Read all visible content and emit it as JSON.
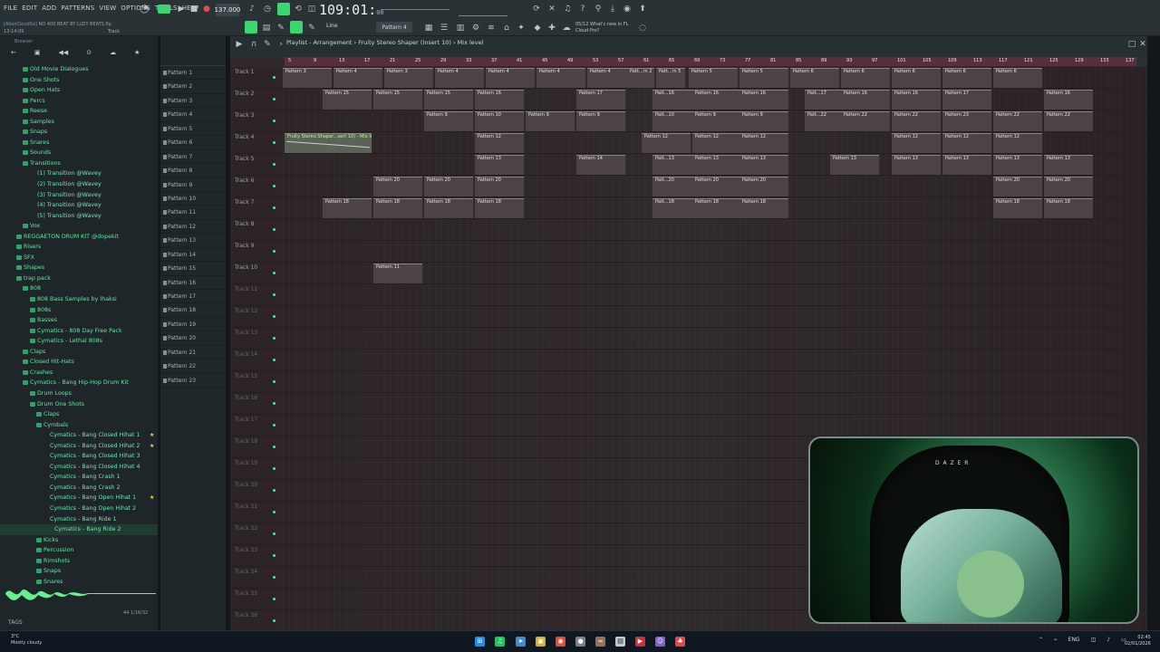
{
  "menu": [
    "FILE",
    "EDIT",
    "ADD",
    "PATTERNS",
    "VIEW",
    "OPTIONS",
    "TOOLS",
    "HELP"
  ],
  "project": {
    "hint": "[AlienCloudSo]",
    "title": "NO 400 BEAT BY LUZY BEATS.flp",
    "time": "13:14:09",
    "track": "Track 3"
  },
  "tempo": "137.000",
  "clock_main": "109:01",
  "clock_small": "00",
  "pattern_select": "Pattern 4",
  "news": [
    "05/12",
    "What's new in FL",
    "Cloud Pro?"
  ],
  "playlist_title": "Playlist - Arrangement › Fruity Stereo Shaper (Insert 10) › Mix level",
  "browser_label": "Browser",
  "browser_items": [
    {
      "label": "Old Movie Dialogues",
      "indent": 1,
      "type": "folder"
    },
    {
      "label": "One Shots",
      "indent": 1,
      "type": "folder"
    },
    {
      "label": "Open Hats",
      "indent": 1,
      "type": "folder"
    },
    {
      "label": "Percs",
      "indent": 1,
      "type": "folder"
    },
    {
      "label": "Reese",
      "indent": 1,
      "type": "folder"
    },
    {
      "label": "Samples",
      "indent": 1,
      "type": "folder"
    },
    {
      "label": "Snaps",
      "indent": 1,
      "type": "folder"
    },
    {
      "label": "Snares",
      "indent": 1,
      "type": "folder"
    },
    {
      "label": "Sounds",
      "indent": 1,
      "type": "folder"
    },
    {
      "label": "Transitions",
      "indent": 1,
      "type": "folder"
    },
    {
      "label": "(1) Transition @Wavey",
      "indent": 2,
      "type": "file"
    },
    {
      "label": "(2) Transition @Wavey",
      "indent": 2,
      "type": "file"
    },
    {
      "label": "(3) Transition @Wavey",
      "indent": 2,
      "type": "file"
    },
    {
      "label": "(4) Transition @Wavey",
      "indent": 2,
      "type": "file"
    },
    {
      "label": "(5) Transition @Wavey",
      "indent": 2,
      "type": "file"
    },
    {
      "label": "Vox",
      "indent": 1,
      "type": "folder"
    },
    {
      "label": "REGGAETON DRUM KIT @dopekit",
      "indent": 0,
      "type": "folder"
    },
    {
      "label": "Risers",
      "indent": 0,
      "type": "folder"
    },
    {
      "label": "SFX",
      "indent": 0,
      "type": "folder"
    },
    {
      "label": "Shapes",
      "indent": 0,
      "type": "folder"
    },
    {
      "label": "trap pack",
      "indent": 0,
      "type": "folder"
    },
    {
      "label": "808",
      "indent": 1,
      "type": "folder"
    },
    {
      "label": "808 Bass Samples by Ihaksi",
      "indent": 2,
      "type": "folder"
    },
    {
      "label": "808s",
      "indent": 2,
      "type": "folder"
    },
    {
      "label": "Basses",
      "indent": 2,
      "type": "folder"
    },
    {
      "label": "Cymatics - 808 Day Free Pack",
      "indent": 2,
      "type": "folder"
    },
    {
      "label": "Cymatics - Lethal 808s",
      "indent": 2,
      "type": "folder"
    },
    {
      "label": "Claps",
      "indent": 1,
      "type": "folder"
    },
    {
      "label": "Closed Hit-Hats",
      "indent": 1,
      "type": "folder"
    },
    {
      "label": "Crashes",
      "indent": 1,
      "type": "folder"
    },
    {
      "label": "Cymatics - Bang Hip-Hop Drum Kit",
      "indent": 1,
      "type": "folder"
    },
    {
      "label": "Drum Loops",
      "indent": 2,
      "type": "folder"
    },
    {
      "label": "Drum One Shots",
      "indent": 2,
      "type": "folder"
    },
    {
      "label": "Claps",
      "indent": 3,
      "type": "folder"
    },
    {
      "label": "Cymbals",
      "indent": 3,
      "type": "folder"
    },
    {
      "label": "Cymatics - Bang Closed Hihat 1",
      "indent": 4,
      "type": "file",
      "star": true
    },
    {
      "label": "Cymatics - Bang Closed Hihat 2",
      "indent": 4,
      "type": "file",
      "star": true
    },
    {
      "label": "Cymatics - Bang Closed Hihat 3",
      "indent": 4,
      "type": "file"
    },
    {
      "label": "Cymatics - Bang Closed Hihat 4",
      "indent": 4,
      "type": "file"
    },
    {
      "label": "Cymatics - Bang Crash 1",
      "indent": 4,
      "type": "file"
    },
    {
      "label": "Cymatics - Bang Crash 2",
      "indent": 4,
      "type": "file"
    },
    {
      "label": "Cymatics - Bang Open Hihat 1",
      "indent": 4,
      "type": "file",
      "star": true
    },
    {
      "label": "Cymatics - Bang Open Hihat 2",
      "indent": 4,
      "type": "file"
    },
    {
      "label": "Cymatics - Bang Ride 1",
      "indent": 4,
      "type": "file"
    },
    {
      "label": "Cymatics - Bang Ride 2",
      "indent": 5,
      "type": "file",
      "selected": true
    },
    {
      "label": "Kicks",
      "indent": 3,
      "type": "folder"
    },
    {
      "label": "Percussion",
      "indent": 3,
      "type": "folder"
    },
    {
      "label": "Rimshots",
      "indent": 3,
      "type": "folder"
    },
    {
      "label": "Snaps",
      "indent": 3,
      "type": "folder"
    },
    {
      "label": "Snares",
      "indent": 3,
      "type": "folder"
    }
  ],
  "sample_rate": "44.1/16/32",
  "tags_label": "TAGS",
  "patterns": [
    "Pattern 1",
    "Pattern 2",
    "Pattern 3",
    "Pattern 4",
    "Pattern 5",
    "Pattern 6",
    "Pattern 7",
    "Pattern 8",
    "Pattern 9",
    "Pattern 10",
    "Pattern 11",
    "Pattern 12",
    "Pattern 13",
    "Pattern 14",
    "Pattern 15",
    "Pattern 16",
    "Pattern 17",
    "Pattern 18",
    "Pattern 19",
    "Pattern 20",
    "Pattern 21",
    "Pattern 22",
    "Pattern 23"
  ],
  "ruler": [
    "5",
    "9",
    "13",
    "17",
    "21",
    "25",
    "29",
    "33",
    "37",
    "41",
    "45",
    "49",
    "53",
    "57",
    "61",
    "65",
    "69",
    "73",
    "77",
    "81",
    "85",
    "89",
    "93",
    "97",
    "101",
    "105",
    "109",
    "113",
    "117",
    "121",
    "125",
    "129",
    "133",
    "137"
  ],
  "tracks": [
    "Track 1",
    "Track 2",
    "Track 3",
    "Track 4",
    "Track 5",
    "Track 6",
    "Track 7",
    "Track 8",
    "Track 9",
    "Track 10",
    "Track 11",
    "Track 12",
    "Track 13",
    "Track 14",
    "Track 15",
    "Track 16",
    "Track 17",
    "Track 18",
    "Track 19",
    "Track 20",
    "Track 21",
    "Track 22",
    "Track 23",
    "Track 24",
    "Track 25",
    "Track 26"
  ],
  "clips": [
    {
      "row": 0,
      "label": "Pattern 3"
    },
    {
      "row": 0,
      "label": "Pattern 4"
    },
    {
      "row": 0,
      "label": "Pattern 3"
    },
    {
      "row": 0,
      "label": "Pattern 4"
    },
    {
      "row": 0,
      "label": "Pattern 4"
    },
    {
      "row": 0,
      "label": "Pattern 4"
    },
    {
      "row": 0,
      "label": "Pattern 4"
    },
    {
      "row": 0,
      "label": "Patt...rn 2"
    },
    {
      "row": 0,
      "label": "Patt...rn 5"
    },
    {
      "row": 0,
      "label": "Pattern 5"
    },
    {
      "row": 0,
      "label": "Pattern 5"
    },
    {
      "row": 0,
      "label": "Pattern 6"
    },
    {
      "row": 0,
      "label": "Pattern 6"
    },
    {
      "row": 0,
      "label": "Pattern 6"
    },
    {
      "row": 0,
      "label": "Pattern 6"
    },
    {
      "row": 0,
      "label": "Pattern 6"
    },
    {
      "row": 1,
      "label": "Pattern 15"
    },
    {
      "row": 1,
      "label": "Pattern 15"
    },
    {
      "row": 1,
      "label": "Pattern 15"
    },
    {
      "row": 1,
      "label": "Pattern 16"
    },
    {
      "row": 1,
      "label": "Pattern 17"
    },
    {
      "row": 1,
      "label": "Patt...16"
    },
    {
      "row": 1,
      "label": "Pattern 16"
    },
    {
      "row": 1,
      "label": "Pattern 16"
    },
    {
      "row": 1,
      "label": "Patt...17"
    },
    {
      "row": 1,
      "label": "Pattern 16"
    },
    {
      "row": 1,
      "label": "Pattern 16"
    },
    {
      "row": 1,
      "label": "Pattern 17"
    },
    {
      "row": 1,
      "label": "Pattern 16"
    },
    {
      "row": 2,
      "label": "Pattern 9"
    },
    {
      "row": 2,
      "label": "Pattern 10"
    },
    {
      "row": 2,
      "label": "Pattern 9"
    },
    {
      "row": 2,
      "label": "Pattern 9"
    },
    {
      "row": 2,
      "label": "Patt...10"
    },
    {
      "row": 2,
      "label": "Pattern 9"
    },
    {
      "row": 2,
      "label": "Pattern 9"
    },
    {
      "row": 2,
      "label": "Patt...22"
    },
    {
      "row": 2,
      "label": "Pattern 22"
    },
    {
      "row": 2,
      "label": "Pattern 22"
    },
    {
      "row": 2,
      "label": "Pattern 23"
    },
    {
      "row": 2,
      "label": "Pattern 22"
    },
    {
      "row": 2,
      "label": "Pattern 22"
    },
    {
      "row": 3,
      "label": "Fruity Stereo Shaper...sert 10) - Mix level",
      "fx": true
    },
    {
      "row": 3,
      "label": "Pattern 12"
    },
    {
      "row": 3,
      "label": "Pattern 12"
    },
    {
      "row": 3,
      "label": "Pattern 12"
    },
    {
      "row": 3,
      "label": "Pattern 12"
    },
    {
      "row": 3,
      "label": "Pattern 12"
    },
    {
      "row": 3,
      "label": "Pattern 12"
    },
    {
      "row": 3,
      "label": "Pattern 12"
    },
    {
      "row": 4,
      "label": "Pattern 13"
    },
    {
      "row": 4,
      "label": "Pattern 14"
    },
    {
      "row": 4,
      "label": "Patt...13"
    },
    {
      "row": 4,
      "label": "Pattern 13"
    },
    {
      "row": 4,
      "label": "Pattern 13"
    },
    {
      "row": 4,
      "label": "Pattern 13"
    },
    {
      "row": 4,
      "label": "Pattern 13"
    },
    {
      "row": 4,
      "label": "Pattern 13"
    },
    {
      "row": 4,
      "label": "Pattern 13"
    },
    {
      "row": 4,
      "label": "Pattern 13"
    },
    {
      "row": 5,
      "label": "Pattern 20"
    },
    {
      "row": 5,
      "label": "Pattern 20"
    },
    {
      "row": 5,
      "label": "Pattern 20"
    },
    {
      "row": 5,
      "label": "Patt...20"
    },
    {
      "row": 5,
      "label": "Pattern 20"
    },
    {
      "row": 5,
      "label": "Pattern 20"
    },
    {
      "row": 5,
      "label": "Pattern 20"
    },
    {
      "row": 5,
      "label": "Pattern 20"
    },
    {
      "row": 6,
      "label": "Pattern 18"
    },
    {
      "row": 6,
      "label": "Pattern 18"
    },
    {
      "row": 6,
      "label": "Pattern 18"
    },
    {
      "row": 6,
      "label": "Pattern 18"
    },
    {
      "row": 6,
      "label": "Patt...18"
    },
    {
      "row": 6,
      "label": "Pattern 18"
    },
    {
      "row": 6,
      "label": "Pattern 18"
    },
    {
      "row": 6,
      "label": "Pattern 18"
    },
    {
      "row": 6,
      "label": "Pattern 18"
    },
    {
      "row": 9,
      "label": "Pattern 11"
    }
  ],
  "webcam_text": "D A Z E R",
  "taskbar": {
    "weather_temp": "3°C",
    "weather_text": "Mostly cloudy",
    "lang": "ENG",
    "time": "02:45",
    "date": "02/01/2026"
  }
}
